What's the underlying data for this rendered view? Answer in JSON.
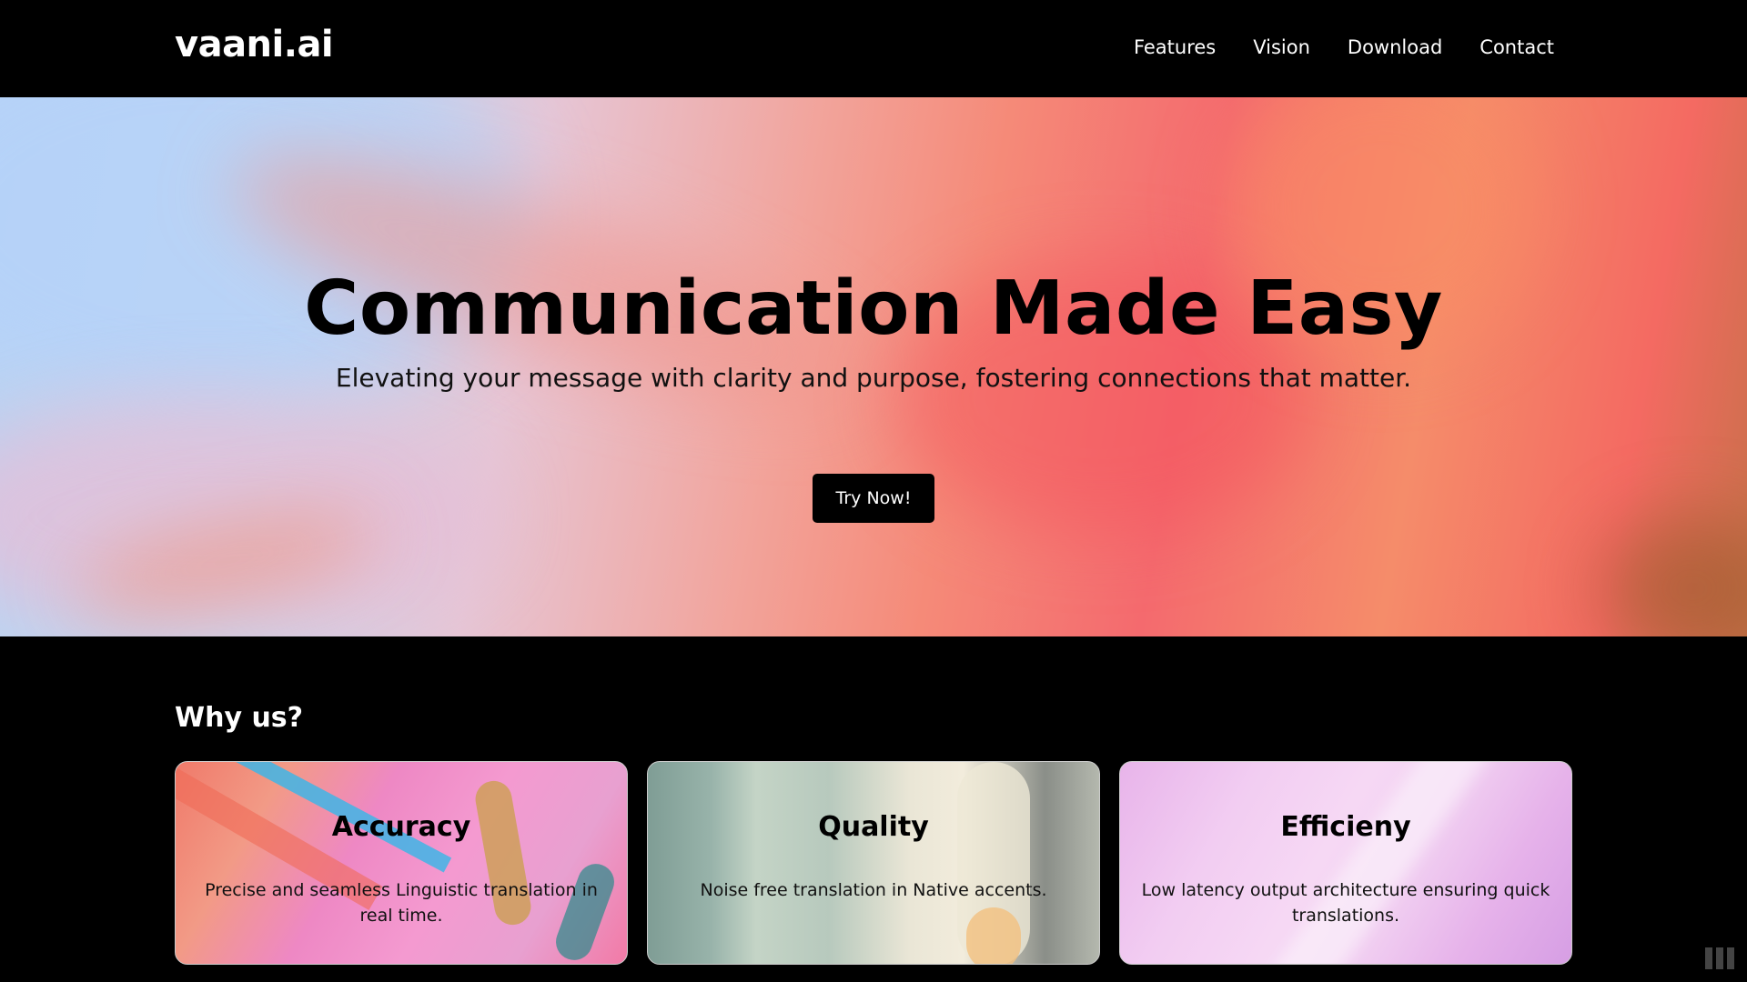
{
  "navbar": {
    "logo": "vaani.ai",
    "links": [
      "Features",
      "Vision",
      "Download",
      "Contact"
    ]
  },
  "hero": {
    "title": "Communication Made Easy",
    "subtitle": "Elevating your message with clarity and purpose, fostering connections that matter.",
    "cta_label": "Try Now!"
  },
  "features": {
    "heading": "Why us?",
    "cards": [
      {
        "title": "Accuracy",
        "description": "Precise and seamless Linguistic translation in real time."
      },
      {
        "title": "Quality",
        "description": "Noise free translation in Native accents."
      },
      {
        "title": "Efficieny",
        "description": "Low latency output architecture ensuring quick translations."
      }
    ]
  },
  "colors": {
    "background": "#000000",
    "text_light": "#ffffff",
    "text_dark": "#000000",
    "button": "#000000"
  },
  "icons": [
    "scroll-indicator-icon"
  ]
}
